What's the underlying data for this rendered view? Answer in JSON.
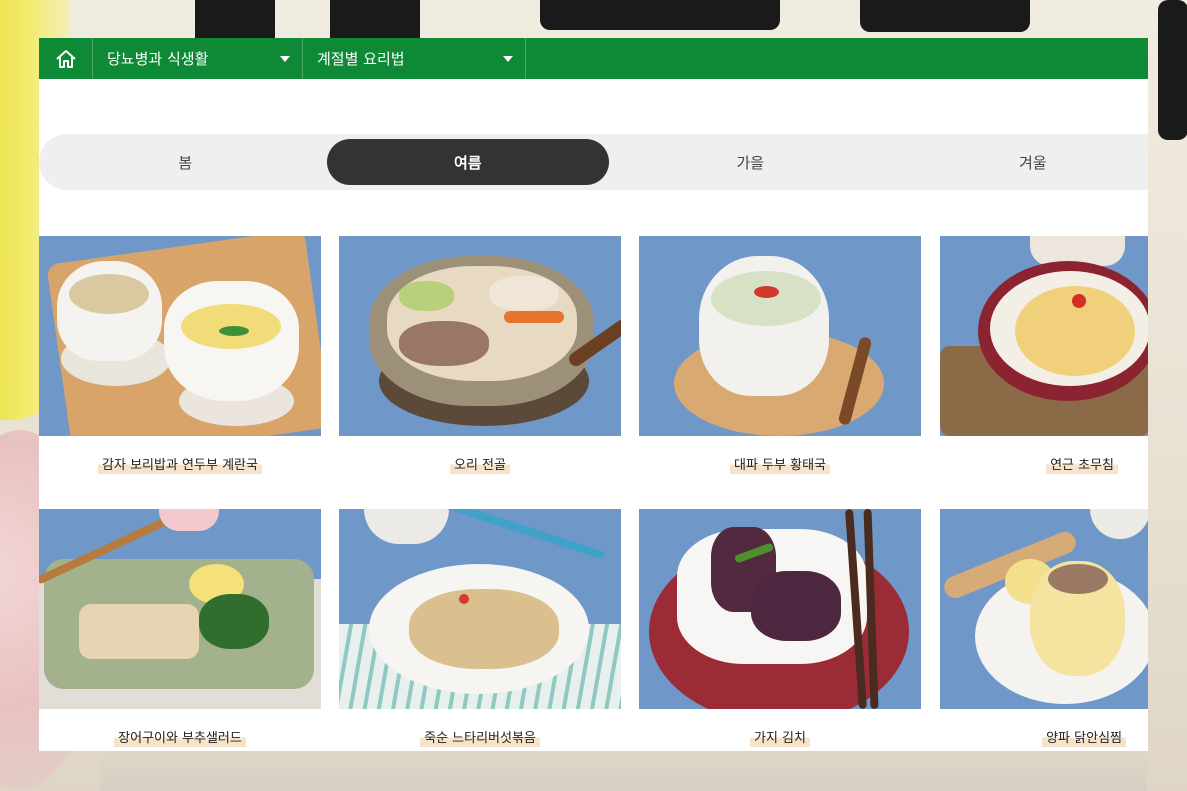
{
  "nav": {
    "home_icon": "home-icon",
    "dropdowns": [
      {
        "label": "당뇨병과 식생활"
      },
      {
        "label": "계절별 요리법"
      }
    ]
  },
  "seasons": {
    "tabs": [
      {
        "label": "봄",
        "active": false
      },
      {
        "label": "여름",
        "active": true
      },
      {
        "label": "가을",
        "active": false
      },
      {
        "label": "겨울",
        "active": false
      }
    ]
  },
  "recipes": [
    {
      "title": "감자 보리밥과 연두부 계란국"
    },
    {
      "title": "오리 전골"
    },
    {
      "title": "대파 두부 황태국"
    },
    {
      "title": "연근 초무침"
    },
    {
      "title": "장어구이와 부추샐러드"
    },
    {
      "title": "죽순 느타리버섯볶음"
    },
    {
      "title": "가지 김치"
    },
    {
      "title": "양파 닭안심찜"
    }
  ],
  "colors": {
    "nav_green": "#0e8a36",
    "active_tab": "#333333",
    "caption_highlight": "#f6e3c9"
  }
}
